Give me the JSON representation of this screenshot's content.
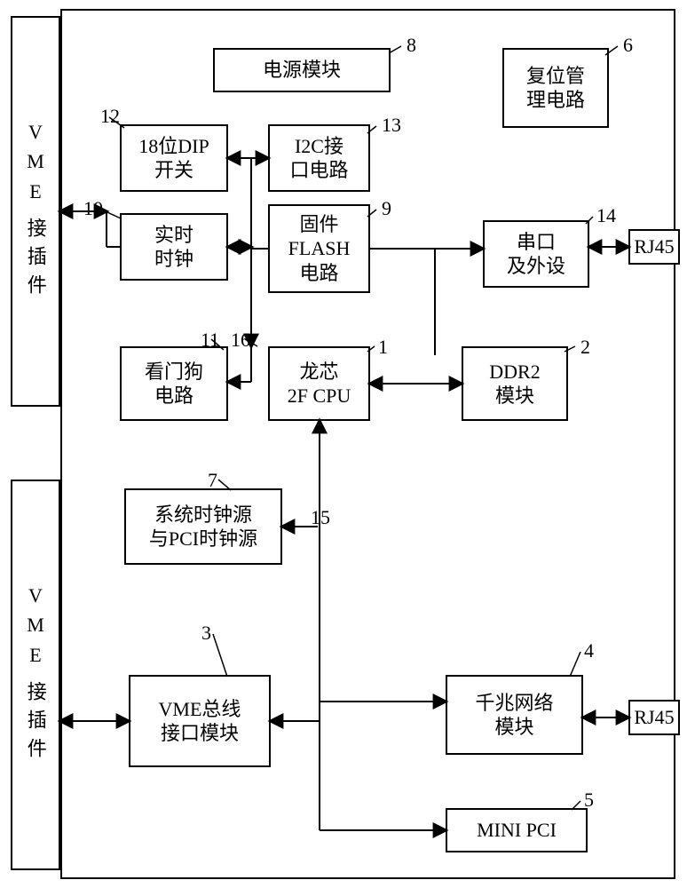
{
  "outer_frame": {},
  "vme_top": {
    "line1": "V",
    "line2": "M",
    "line3": "E",
    "label_cn": "接插件"
  },
  "vme_bottom": {
    "line1": "V",
    "line2": "M",
    "line3": "E",
    "label_cn": "接插件"
  },
  "rj45_top": "RJ45",
  "rj45_bottom": "RJ45",
  "blocks": {
    "power": {
      "num": "8",
      "l1": "电源模块"
    },
    "reset": {
      "num": "6",
      "l1": "复位管",
      "l2": "理电路"
    },
    "dip": {
      "num": "12",
      "l1": "18位DIP",
      "l2": "开关"
    },
    "i2c": {
      "num": "13",
      "l1": "I2C接",
      "l2": "口电路"
    },
    "rtc": {
      "num": "10",
      "l1": "实时",
      "l2": "时钟"
    },
    "flash": {
      "num": "9",
      "l1": "固件",
      "l2": "FLASH",
      "l3": "电路"
    },
    "serial": {
      "num": "14",
      "l1": "串口",
      "l2": "及外设"
    },
    "watchdog": {
      "num": "11",
      "l1": "看门狗",
      "l2": "电路"
    },
    "cpu": {
      "num": "1",
      "l1": "龙芯",
      "l2": "2F CPU",
      "extra_num": "16"
    },
    "ddr2": {
      "num": "2",
      "l1": "DDR2",
      "l2": "模块"
    },
    "clocks": {
      "num": "7",
      "l1": "系统时钟源",
      "l2": "与PCI时钟源"
    },
    "bus15": {
      "num": "15"
    },
    "vmebus": {
      "num": "3",
      "l1": "VME总线",
      "l2": "接口模块"
    },
    "giga": {
      "num": "4",
      "l1": "千兆网络",
      "l2": "模块"
    },
    "minipci": {
      "num": "5",
      "l1": "MINI PCI"
    }
  }
}
